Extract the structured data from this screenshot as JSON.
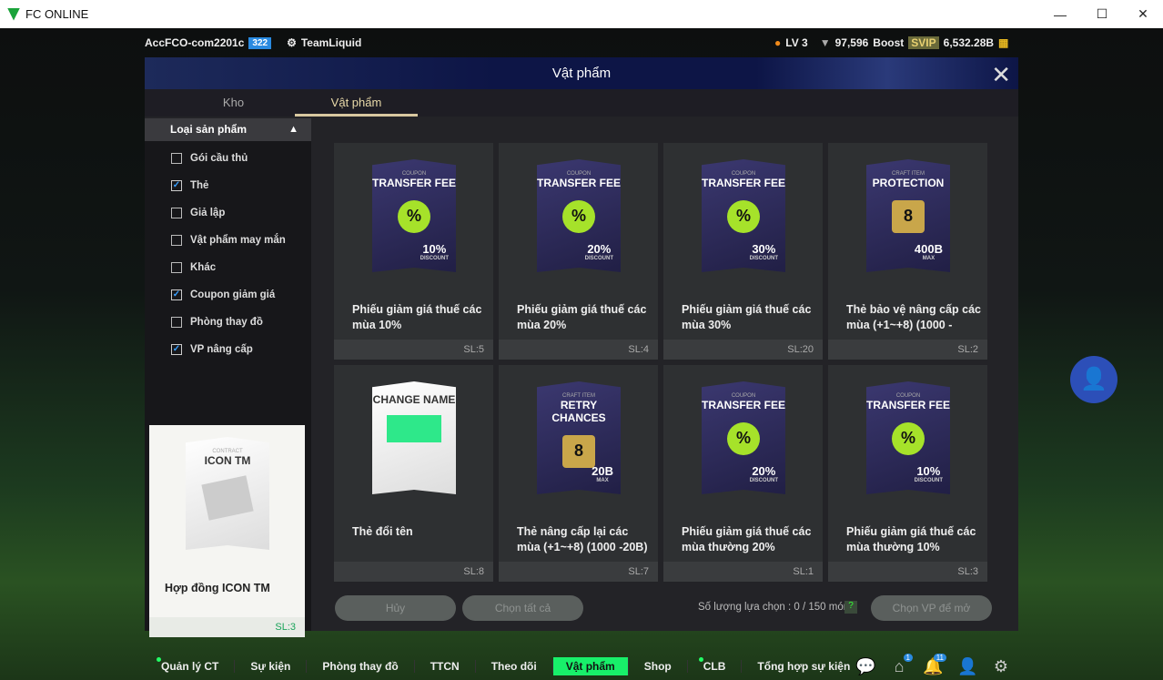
{
  "window": {
    "title": "FC ONLINE"
  },
  "topbar": {
    "account": "AccFCO-com2201c",
    "account_badge": "322",
    "team": "TeamLiquid",
    "level": "LV 3",
    "points": "97,596",
    "boost": "Boost",
    "svip": "SVIP",
    "currency": "6,532.28B"
  },
  "panel": {
    "title": "Vật phẩm",
    "tabs": [
      "Kho",
      "Vật phẩm"
    ],
    "active_tab": "Vật phẩm"
  },
  "filter": {
    "header": "Loại sản phẩm",
    "items": [
      {
        "label": "Gói cầu thủ",
        "checked": false
      },
      {
        "label": "Thẻ",
        "checked": true
      },
      {
        "label": "Giả lập",
        "checked": false
      },
      {
        "label": "Vật phẩm may mắn",
        "checked": false
      },
      {
        "label": "Khác",
        "checked": false
      },
      {
        "label": "Coupon giảm giá",
        "checked": true
      },
      {
        "label": "Phòng thay đồ",
        "checked": false
      },
      {
        "label": "VP nâng cấp",
        "checked": true
      }
    ]
  },
  "hover_card": {
    "kicker": "CONTRACT",
    "art_title": "ICON TM",
    "name": "Hợp đồng ICON TM",
    "qty": "SL:3"
  },
  "items": [
    {
      "kicker": "COUPON",
      "art_title": "TRANSFER FEE",
      "badge": "%",
      "value": "10%",
      "value_sub": "DISCOUNT",
      "name": "Phiếu giảm giá thuế các mùa 10%",
      "qty": "SL:5"
    },
    {
      "kicker": "COUPON",
      "art_title": "TRANSFER FEE",
      "badge": "%",
      "value": "20%",
      "value_sub": "DISCOUNT",
      "name": "Phiếu giảm giá thuế các mùa 20%",
      "qty": "SL:4"
    },
    {
      "kicker": "COUPON",
      "art_title": "TRANSFER FEE",
      "badge": "%",
      "value": "30%",
      "value_sub": "DISCOUNT",
      "name": "Phiếu giảm giá thuế các mùa 30%",
      "qty": "SL:20"
    },
    {
      "kicker": "CRAFT ITEM",
      "art_title": "PROTECTION",
      "badge": "8",
      "value": "400B",
      "value_sub": "MAX",
      "name": "Thẻ bảo vệ nâng cấp các mùa (+1~+8) (1000 -",
      "qty": "SL:2"
    },
    {
      "kicker": "",
      "art_title": "CHANGE NAME",
      "badge": "",
      "value": "",
      "value_sub": "",
      "name": "Thẻ đổi tên",
      "qty": "SL:8",
      "white": true
    },
    {
      "kicker": "CRAFT ITEM",
      "art_title": "RETRY CHANCES",
      "badge": "8",
      "value": "20B",
      "value_sub": "MAX",
      "name": "Thẻ nâng cấp lại các mùa (+1~+8) (1000 -20B)",
      "qty": "SL:7"
    },
    {
      "kicker": "COUPON",
      "art_title": "TRANSFER FEE",
      "badge": "%",
      "value": "20%",
      "value_sub": "DISCOUNT",
      "name": "Phiếu giảm giá thuế các mùa thường 20%",
      "qty": "SL:1"
    },
    {
      "kicker": "COUPON",
      "art_title": "TRANSFER FEE",
      "badge": "%",
      "value": "10%",
      "value_sub": "DISCOUNT",
      "name": "Phiếu giảm giá thuế các mùa thường 10%",
      "qty": "SL:3"
    }
  ],
  "actions": {
    "cancel": "Hủy",
    "select_all": "Chọn tất cả",
    "selection_count": "Số lượng lựa chọn : 0 / 150 món",
    "help": "?",
    "open": "Chọn VP để mở"
  },
  "nav": {
    "items": [
      "Quản lý CT",
      "Sự kiện",
      "Phòng thay đồ",
      "TTCN",
      "Theo dõi",
      "Vật phẩm",
      "Shop",
      "CLB",
      "Tổng hợp sự kiện"
    ],
    "active": "Vật phẩm",
    "home_badge": "1",
    "bell_badge": "11"
  },
  "colors": {
    "accent": "#18f06a",
    "panel": "#232327",
    "coupon_seal": "#a6e22a"
  }
}
